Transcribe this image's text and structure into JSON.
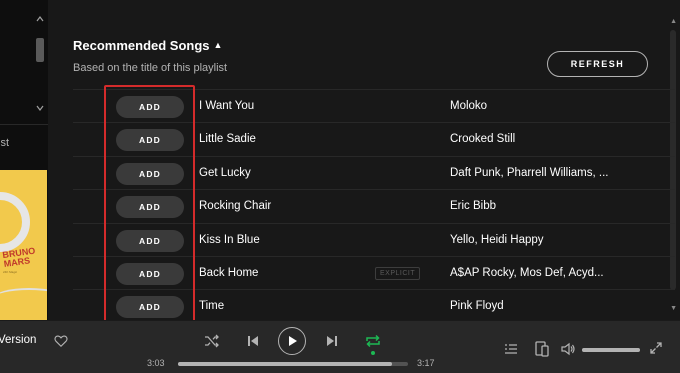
{
  "sidebar": {
    "partial_text": "ist",
    "album": {
      "title": "BRUNO MARS",
      "subtitle": "24K Magic"
    }
  },
  "section": {
    "title": "Recommended Songs",
    "subtitle": "Based on the title of this playlist",
    "refresh_label": "REFRESH"
  },
  "songs": [
    {
      "add_label": "ADD",
      "title": "I Want You",
      "artist": "Moloko",
      "explicit": ""
    },
    {
      "add_label": "ADD",
      "title": "Little Sadie",
      "artist": "Crooked Still",
      "explicit": ""
    },
    {
      "add_label": "ADD",
      "title": "Get Lucky",
      "artist": "Daft Punk, Pharrell Williams, ...",
      "explicit": ""
    },
    {
      "add_label": "ADD",
      "title": "Rocking Chair",
      "artist": "Eric Bibb",
      "explicit": ""
    },
    {
      "add_label": "ADD",
      "title": "Kiss In Blue",
      "artist": "Yello, Heidi Happy",
      "explicit": ""
    },
    {
      "add_label": "ADD",
      "title": "Back Home",
      "artist": "A$AP Rocky, Mos Def, Acyd...",
      "explicit": "EXPLICIT"
    },
    {
      "add_label": "ADD",
      "title": "Time",
      "artist": "Pink Floyd",
      "explicit": ""
    }
  ],
  "player": {
    "now_playing": "Version",
    "time_elapsed": "3:03",
    "time_total": "3:17",
    "progress_fraction": 0.93,
    "volume_fraction": 1.0,
    "repeat_active": true
  },
  "colors": {
    "accent_green": "#1db954",
    "highlight_red": "#d42b2b",
    "background": "#181818"
  }
}
